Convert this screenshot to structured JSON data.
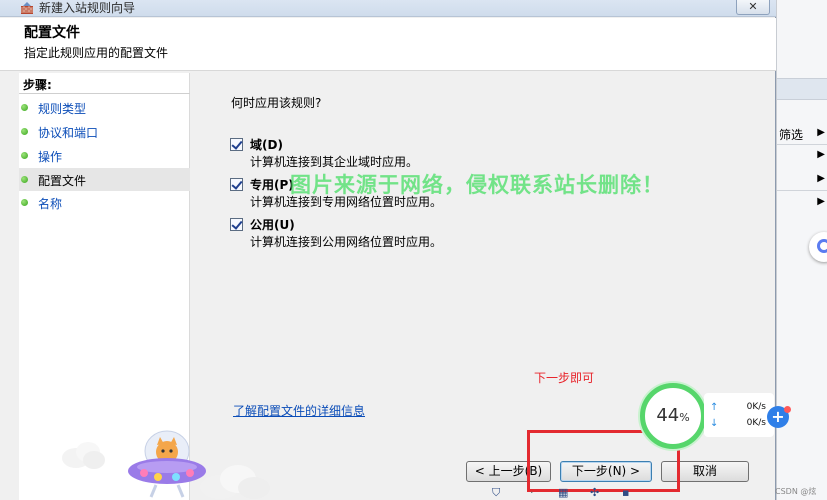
{
  "window": {
    "title": "新建入站规则向导",
    "close_label": "✕"
  },
  "header": {
    "title": "配置文件",
    "subtitle": "指定此规则应用的配置文件"
  },
  "steps": {
    "label": "步骤:",
    "items": [
      {
        "label": "规则类型"
      },
      {
        "label": "协议和端口"
      },
      {
        "label": "操作"
      },
      {
        "label": "配置文件"
      },
      {
        "label": "名称"
      }
    ],
    "current_index": 3
  },
  "content": {
    "question": "何时应用该规则?",
    "options": [
      {
        "label": "域(D)",
        "desc": "计算机连接到其企业域时应用。",
        "checked": true
      },
      {
        "label": "专用(P)",
        "desc": "计算机连接到专用网络位置时应用。",
        "checked": true
      },
      {
        "label": "公用(U)",
        "desc": "计算机连接到公用网络位置时应用。",
        "checked": true
      }
    ],
    "learn_link": "了解配置文件的详细信息",
    "watermark": "图片来源于网络，侵权联系站长删除！",
    "annotation": "下一步即可"
  },
  "buttons": {
    "back": "< 上一步(B)",
    "next": "下一步(N) >",
    "cancel": "取消"
  },
  "speed_widget": {
    "percent": "44",
    "percent_unit": "%",
    "up": "0K/s",
    "down": "0K/s",
    "up_arrow": "↑",
    "down_arrow": "↓",
    "plus": "+"
  },
  "background_app": {
    "menu_label": "筛选",
    "arrow": "▶"
  },
  "credit": "CSDN @炫o。",
  "colors": {
    "accent_red": "#e32a30",
    "link_blue": "#0b4db8",
    "watermark_green": "#4fe06b",
    "ring_green": "#56d66b"
  }
}
